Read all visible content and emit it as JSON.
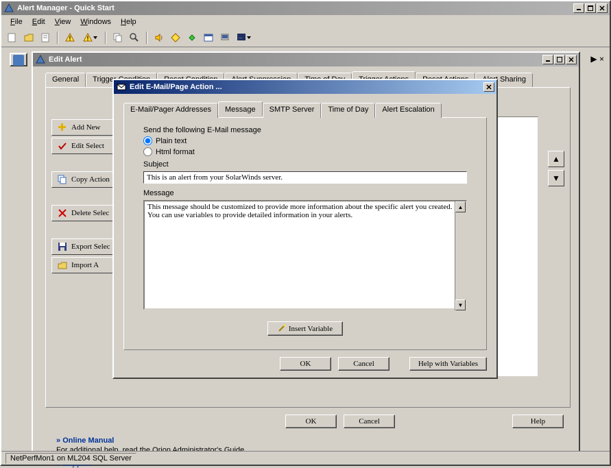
{
  "main_window": {
    "title": "Alert Manager - Quick Start"
  },
  "menu": {
    "file": "File",
    "edit": "Edit",
    "view": "View",
    "windows": "Windows",
    "help": "Help"
  },
  "edit_alert": {
    "title": "Edit Alert",
    "tabs": {
      "general": "General",
      "trigger_condition": "Trigger Condition",
      "reset_condition": "Reset Condition",
      "alert_suppression": "Alert Suppression",
      "time_of_day": "Time of Day",
      "trigger_actions": "Trigger Actions",
      "reset_actions": "Reset Actions",
      "alert_sharing": "Alert Sharing"
    },
    "sidebar": {
      "add_new": "Add New",
      "edit_selected": "Edit Select",
      "copy_actions": "Copy Action",
      "delete_selected": "Delete Selec",
      "export_selected": "Export Selec",
      "import_actions": "Import A"
    },
    "buttons": {
      "ok": "OK",
      "cancel": "Cancel",
      "help": "Help"
    }
  },
  "email_dialog": {
    "title": "Edit E-Mail/Page Action ...",
    "tabs": {
      "addresses": "E-Mail/Pager Addresses",
      "message": "Message",
      "smtp": "SMTP Server",
      "time_of_day": "Time of Day",
      "escalation": "Alert Escalation"
    },
    "intro": "Send the following E-Mail message",
    "format_options": {
      "plain": "Plain text",
      "html": "Html format"
    },
    "subject_label": "Subject",
    "subject_value": "This is an alert from your SolarWinds server.",
    "message_label": "Message",
    "message_value": "This message should be customized to provide more information about the specific alert you created. You can use variables to provide detailed information in your alerts.",
    "insert_variable": "Insert Variable",
    "buttons": {
      "ok": "OK",
      "cancel": "Cancel",
      "help_vars": "Help with Variables"
    }
  },
  "help_panel": {
    "online_manual": "Online Manual",
    "online_manual_desc": "For additional help, read the Orion Administrator's Guide.",
    "support": "Support"
  },
  "statusbar": {
    "text": "NetPerfMon1 on ML204 SQL Server"
  }
}
